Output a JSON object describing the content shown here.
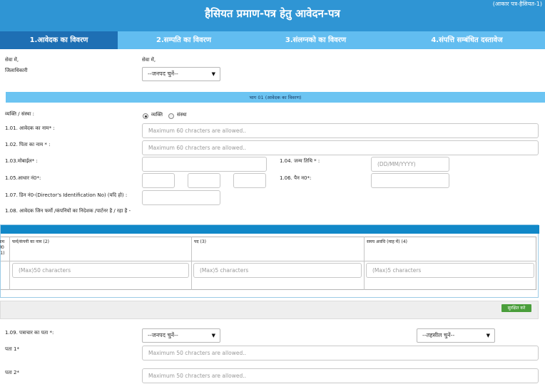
{
  "header": {
    "title": "हैसियत प्रमाण-पत्र हेतु आवेदन-पत्र",
    "form_label": "(आकार पत्र-हैसियत-1)"
  },
  "tabs": [
    {
      "label": "1.आवेदक का विवरण",
      "active": true
    },
    {
      "label": "2.सम्पति का विवरण",
      "active": false
    },
    {
      "label": "3.संलग्नको का विवरण",
      "active": false
    },
    {
      "label": "4.संपत्ति सम्बंधित दस्तावेज",
      "active": false
    }
  ],
  "address": {
    "left_to": "सेवा में,",
    "left_office": "जिलाधिकारी",
    "right_to": "सेवा में,",
    "district_select": "--जनपद चुनें--"
  },
  "section": {
    "title": "भाग 01 (आवेदक का विवरण)"
  },
  "applicant": {
    "type_label": "व्यक्ति / संस्था :",
    "type_option_person": "व्यक्ति",
    "type_option_org": "संस्था",
    "name_label": "1.01. आवेदक का नाम* :",
    "name_placeholder": "Maximum 60 chracters are allowed..",
    "father_label": "1.02. पिता का नाम * :",
    "father_placeholder": "Maximum 60 chracters are allowed..",
    "mobile_label": "1.03.मोबाईल* :",
    "dob_label": "1.04. जन्म तिथि * :",
    "dob_placeholder": "(DD/MM/YYYY)",
    "aadhaar_label": "1.05.आधार नं0*:",
    "pan_label": "1.06. पैन न0*:",
    "din_label": "1.07. डिन नं0-(Director's Identification No) (यदि हो) :",
    "companies_label": "1.08. आवेदक जिन फर्मो /कंपनियों का निदेशक /पार्टनर है / रहा है -"
  },
  "table": {
    "col_sno": "क्रम सं0 (1)",
    "col_firm": "फर्म/कंपनी का नाम (2)",
    "col_post": "पद (3)",
    "col_period": "समय अवधि (माह में) (4)",
    "firm_placeholder": "(Max)50 characters",
    "post_placeholder": "(Max)5 characters",
    "period_placeholder": "(Max)5 characters"
  },
  "save_label": "सुरक्षित करे",
  "correspondence": {
    "label": "1.09. पत्राचार का पता *:",
    "district_select": "--जनपद चुनें--",
    "tehsil_select": "--तहसील चुनें--",
    "addr1_label": "पता 1*",
    "addr1_placeholder": "Maximum 50 chracters are allowed..",
    "addr2_label": "पता 2*",
    "addr2_placeholder": "Maximum 50 chracters are allowed.."
  }
}
